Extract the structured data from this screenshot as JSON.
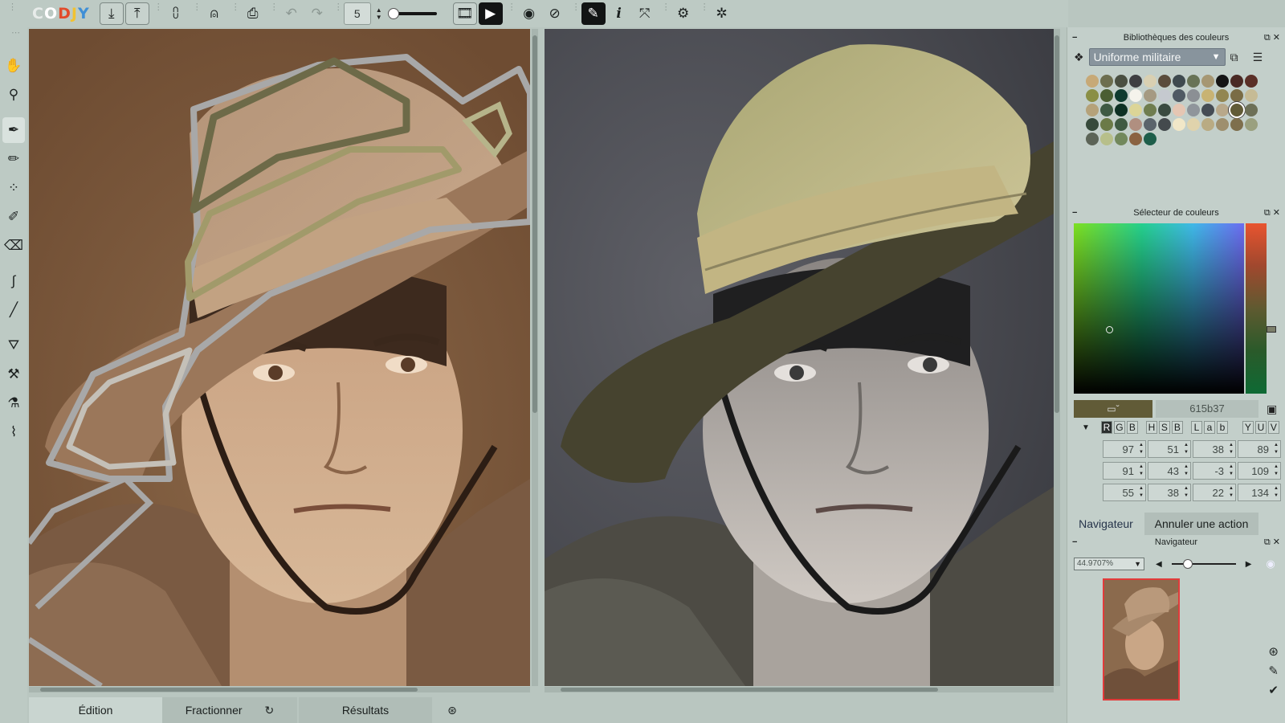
{
  "app": {
    "logo": [
      "C",
      "O",
      "D",
      "J",
      "Y"
    ],
    "logo_colors": [
      "#e8ecea",
      "#ffffff",
      "#e24b2b",
      "#f1c232",
      "#3f8fd6"
    ]
  },
  "toolbar": {
    "buttons": [
      {
        "name": "import-icon",
        "glyph": "⤓"
      },
      {
        "name": "export-icon",
        "glyph": "⤒"
      },
      {
        "name": "print-icon",
        "glyph": "⎙"
      },
      {
        "name": "undo-icon",
        "glyph": "↶"
      },
      {
        "name": "redo-icon",
        "glyph": "↷"
      },
      {
        "name": "eye-icon",
        "glyph": "◉"
      },
      {
        "name": "info-icon",
        "glyph": "i"
      },
      {
        "name": "settings-icon",
        "glyph": "⚙"
      }
    ],
    "brush_size": "5"
  },
  "tools": [
    "hand-icon",
    "lasso-icon",
    "pen-icon",
    "pencil-icon",
    "dotted-pen-icon",
    "marker-icon",
    "eraser-icon",
    "smudge-icon",
    "line-icon",
    "bucket-icon",
    "stamp-icon",
    "dropper-icon",
    "eyedropper-icon"
  ],
  "bottom_tabs": {
    "edition": "Édition",
    "fractionner": "Fractionner",
    "resultats": "Résultats"
  },
  "panels": {
    "library": {
      "title": "Bibliothèques des couleurs",
      "selected_library": "Uniforme militaire",
      "swatches": [
        "#c7a977",
        "#6d6e4f",
        "#4a4f41",
        "#3f3f42",
        "#d9d0b2",
        "#5b4d3c",
        "#3f4a4f",
        "#687356",
        "#a69773",
        "#141414",
        "#4a2a25",
        "#5a2f27",
        "#8a8f45",
        "#4a5e33",
        "#0e3b2f",
        "#f5f3ec",
        "#a59a82",
        "#c5c9cf",
        "#4f5a63",
        "#8b8f94",
        "#c8b373",
        "#928651",
        "#7a6c45",
        "#c6bb95",
        "#b5a27a",
        "#3e5a43",
        "#0d3024",
        "#dcd597",
        "#6f7d4f",
        "#3a4b40",
        "#e5c6b3",
        "#8f959b",
        "#454c54",
        "#b8a88a",
        "#615b37",
        "#6d7057",
        "#374a3b",
        "#6b7a47",
        "#3f5a42",
        "#b08f80",
        "#5a646b",
        "#444a4d",
        "#f1e7c8",
        "#e0d3ac",
        "#b9ab83",
        "#9e8f6e",
        "#7e6f4d",
        "#9aa07f",
        "#5c6457",
        "#b7bf8a",
        "#72885c",
        "#8a6342",
        "#1e5e4a"
      ],
      "selected_swatch_index": 34
    },
    "selector": {
      "title": "Sélecteur de couleurs",
      "hex": "615b37",
      "modes": [
        "R",
        "G",
        "B",
        "H",
        "S",
        "B",
        "L",
        "a",
        "b",
        "Y",
        "U",
        "V"
      ],
      "values": [
        [
          "97",
          "51",
          "38",
          "89"
        ],
        [
          "91",
          "43",
          "-3",
          "109"
        ],
        [
          "55",
          "38",
          "22",
          "134"
        ]
      ]
    },
    "navigator": {
      "tab_active": "Navigateur",
      "tab_inactive": "Annuler une action",
      "title": "Navigateur",
      "zoom": "44.9707%"
    }
  }
}
